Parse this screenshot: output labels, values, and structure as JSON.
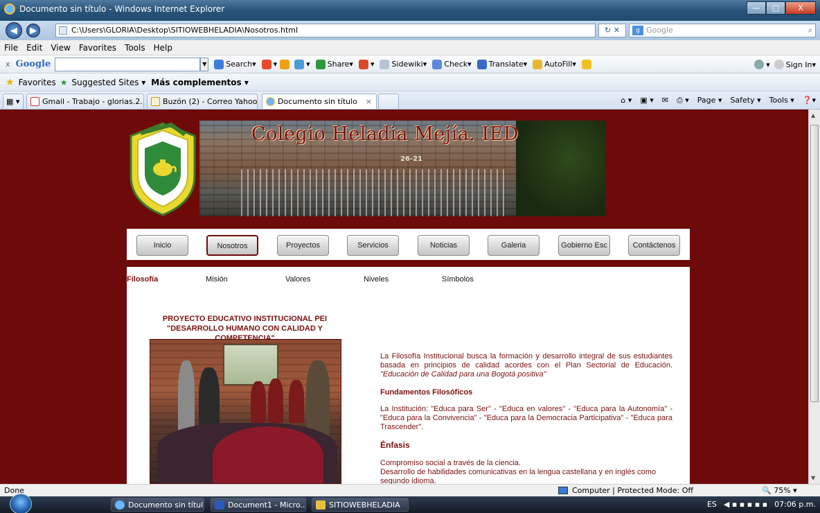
{
  "window": {
    "title": "Documento sin título - Windows Internet Explorer",
    "min": "—",
    "max": "▢",
    "close": "X"
  },
  "addressbar": {
    "url": "C:\\Users\\GLORIA\\Desktop\\SITIOWEBHELADIA\\Nosotros.html",
    "search_placeholder": "Google"
  },
  "menubar": [
    "File",
    "Edit",
    "View",
    "Favorites",
    "Tools",
    "Help"
  ],
  "googlebar": {
    "close": "x",
    "logo": "Google",
    "items": [
      "Search",
      "Share",
      "Sidewiki",
      "Check",
      "Translate",
      "AutoFill"
    ],
    "signin": "Sign In"
  },
  "favorites": {
    "label": "Favorites",
    "suggested": "Suggested Sites ▾",
    "more": "Más complementos ▾"
  },
  "tabs": [
    {
      "label": "Gmail - Trabajo - glorias.2..."
    },
    {
      "label": "Buzón (2) - Correo Yahoo!"
    },
    {
      "label": "Documento sin título"
    }
  ],
  "commandbar": [
    "Page ▾",
    "Safety ▾",
    "Tools ▾"
  ],
  "page": {
    "banner_title": "Colegio Heladia Mejía. IED",
    "banner_number": "26-21",
    "nav": [
      "Inicio",
      "Nosotros",
      "Proyectos",
      "Servicios",
      "Noticias",
      "Galeria",
      "Gobierno Esc",
      "Contáctenos"
    ],
    "subnav": [
      "Filosofía",
      "Misión",
      "Valores",
      "Niveles",
      "Símbolos"
    ],
    "pei_line1": "PROYECTO EDUCATIVO INSTITUCIONAL PEI",
    "pei_line2": "\"DESARROLLO HUMANO CON CALIDAD Y COMPETENCIA\"",
    "para1": "La Filosofía Institucional busca la formación y desarrollo integral de sus estudiantes basada en principios de calidad acordes con el Plan Sectorial de Educación.",
    "para1_em": "\"Educación de Calidad para una Bogotá positiva\"",
    "h_fundamentos": "Fundamentos Filosóficos",
    "para2": "La Institución: \"Educa para Ser\" - \"Educa en valores\" - \"Educa para la Autonomía\" - \"Educa para la Convivencia\" - \"Educa para la Democracia Participativa\" - \"Educa para Trascender\".",
    "h_enfasis": "Énfasis",
    "para3_line1": "Compromiso social a través de la ciencia.",
    "para3_line2": "Desarrollo de habilidades comunicativas en la lengua castellana y en inglés como segundo idioma."
  },
  "statusbar": {
    "left": "Done",
    "zone": "Computer | Protected Mode: Off",
    "zoom": "75%"
  },
  "taskbar": {
    "items": [
      "Documento sin títul...",
      "Document1 - Micro...",
      "SITIOWEBHELADIA"
    ],
    "lang": "ES",
    "time": "07:06 p.m."
  }
}
